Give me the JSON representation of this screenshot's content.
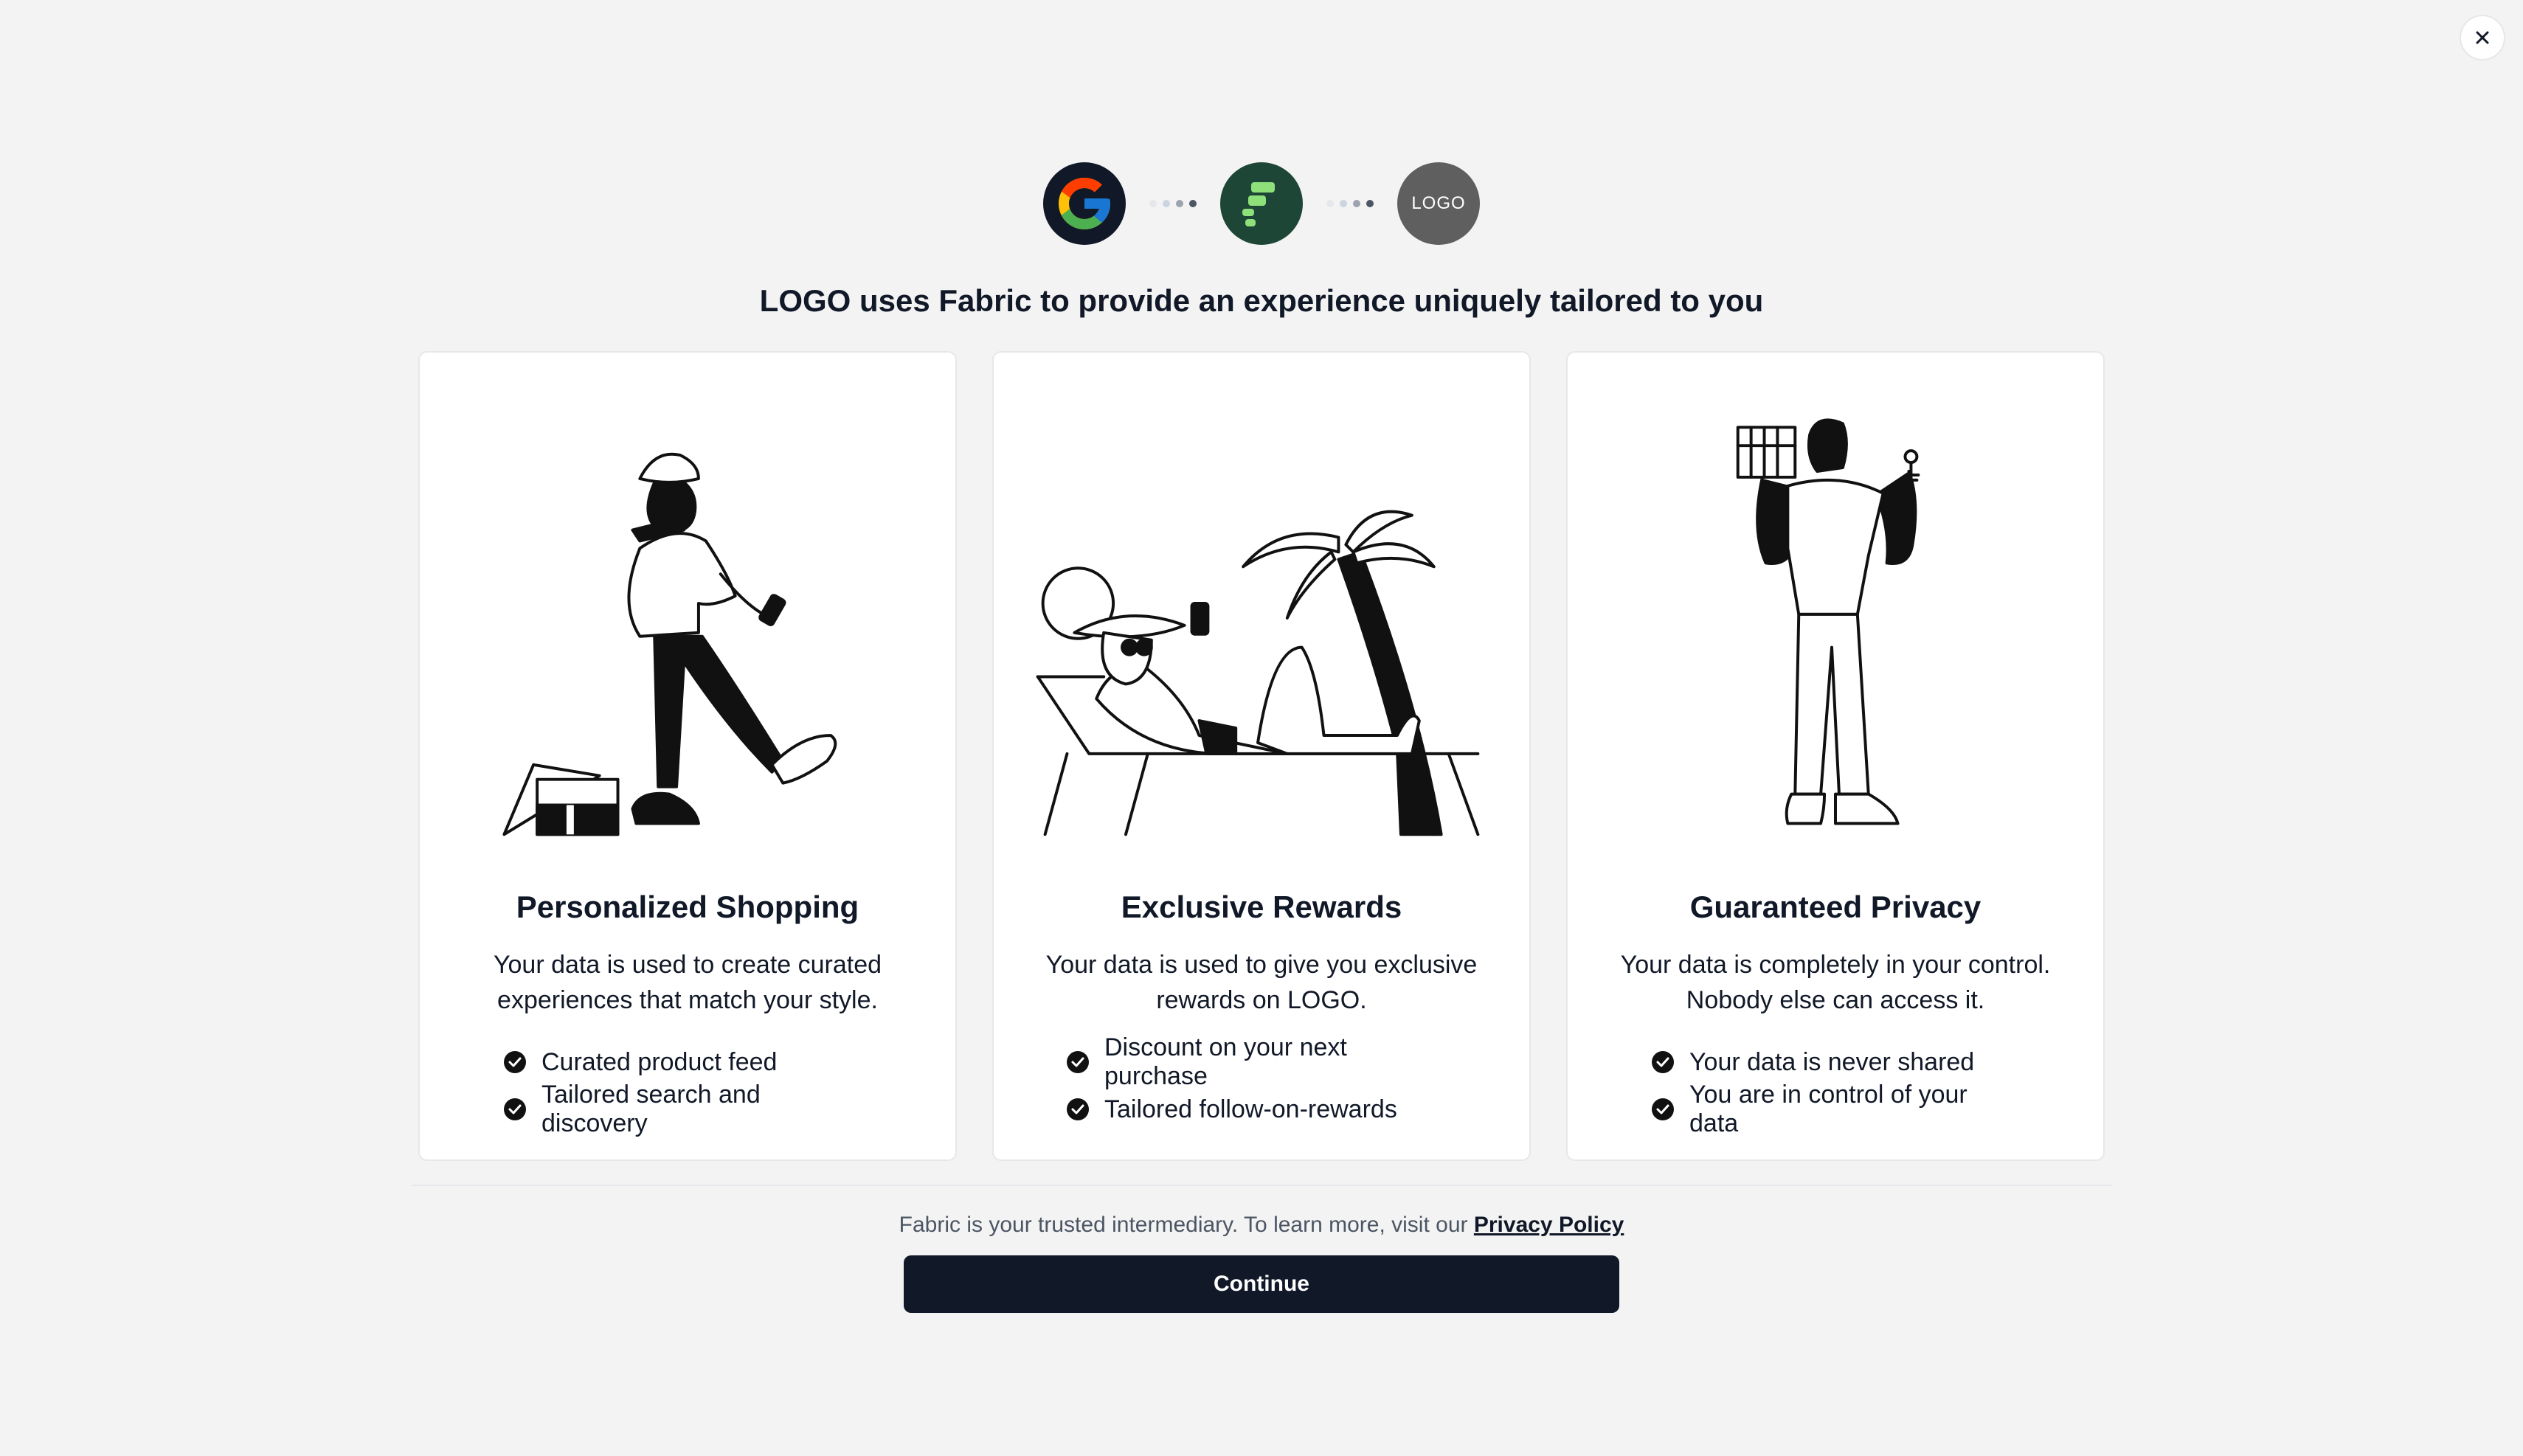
{
  "header": {
    "brand_logo_text": "LOGO",
    "headline": "LOGO uses Fabric to provide an experience uniquely tailored to you",
    "close_icon": "close-icon"
  },
  "cards": [
    {
      "title": "Personalized Shopping",
      "description": "Your data is used to create curated experiences that match your style.",
      "bullets": [
        "Curated product feed",
        "Tailored search and discovery"
      ],
      "illustration": "person-kicking-box-illustration"
    },
    {
      "title": "Exclusive Rewards",
      "description": "Your data is used to give you exclusive rewards on LOGO.",
      "bullets": [
        "Discount on your next purchase",
        "Tailored follow-on-rewards"
      ],
      "illustration": "person-lounging-beach-illustration"
    },
    {
      "title": "Guaranteed Privacy",
      "description": "Your data is completely in your control. Nobody else can access it.",
      "bullets": [
        "Your data is never shared",
        "You are in control of your data"
      ],
      "illustration": "person-holding-cage-and-key-illustration"
    }
  ],
  "footer": {
    "note": "Fabric is your trusted intermediary. To learn more, visit our",
    "privacy_link": "Privacy Policy",
    "continue_label": "Continue"
  },
  "colors": {
    "background": "#f3f3f3",
    "primary_button": "#111827",
    "fabric_green": "#1e4636",
    "fabric_accent": "#8ee07a",
    "brand_logo_bg": "#5f5f5f"
  }
}
